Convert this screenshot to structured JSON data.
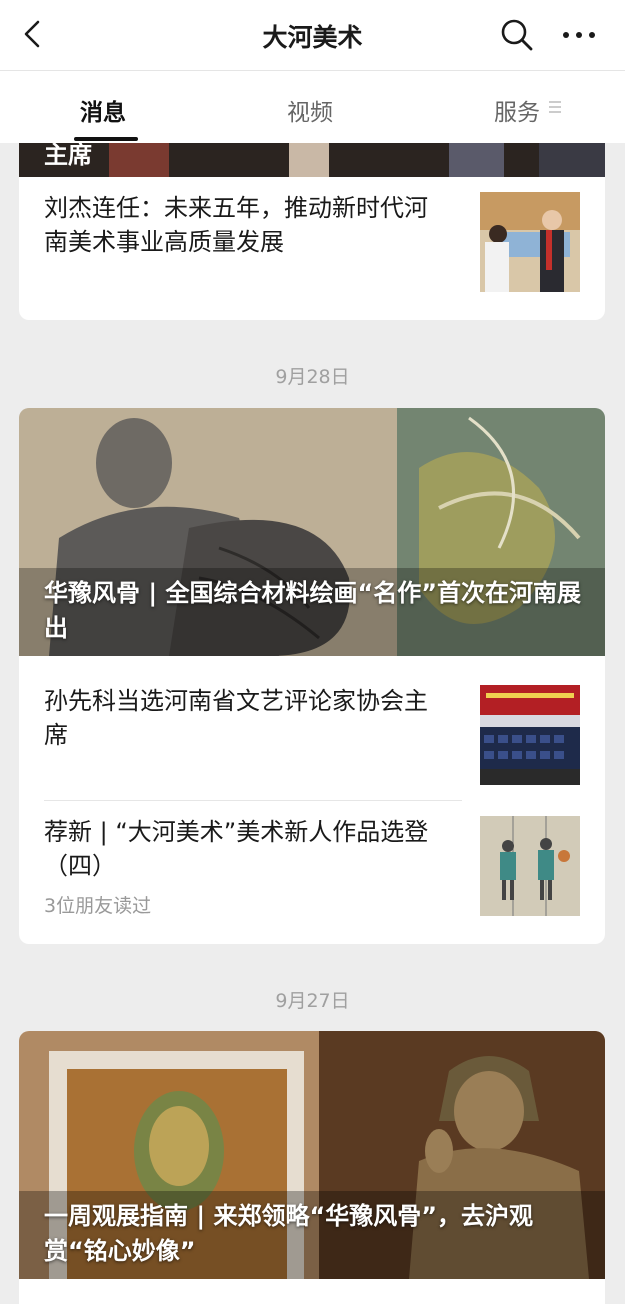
{
  "navbar": {
    "title": "大河美术"
  },
  "tabs": [
    {
      "label": "消息",
      "active": true
    },
    {
      "label": "视频",
      "active": false
    },
    {
      "label": "服务",
      "active": false
    }
  ],
  "top_card": {
    "partial_title": "主席",
    "rows": [
      {
        "title": "刘杰连任：未来五年，推动新时代河南美术事业高质量发展"
      }
    ]
  },
  "groups": [
    {
      "date": "9月28日",
      "hero_title": "华豫风骨 | 全国综合材料绘画“名作”首次在河南展出",
      "rows": [
        {
          "title": "孙先科当选河南省文艺评论家协会主席",
          "sub": ""
        },
        {
          "title": "荐新 | “大河美术”美术新人作品选登（四）",
          "sub": "3位朋友读过"
        }
      ]
    },
    {
      "date": "9月27日",
      "hero_title": "一周观展指南 | 来郑领略“华豫风骨”，去沪观赏“铭心妙像”"
    }
  ],
  "icons": [
    "back-arrow-icon",
    "search-icon",
    "more-dots-icon",
    "tab-menu-icon"
  ]
}
